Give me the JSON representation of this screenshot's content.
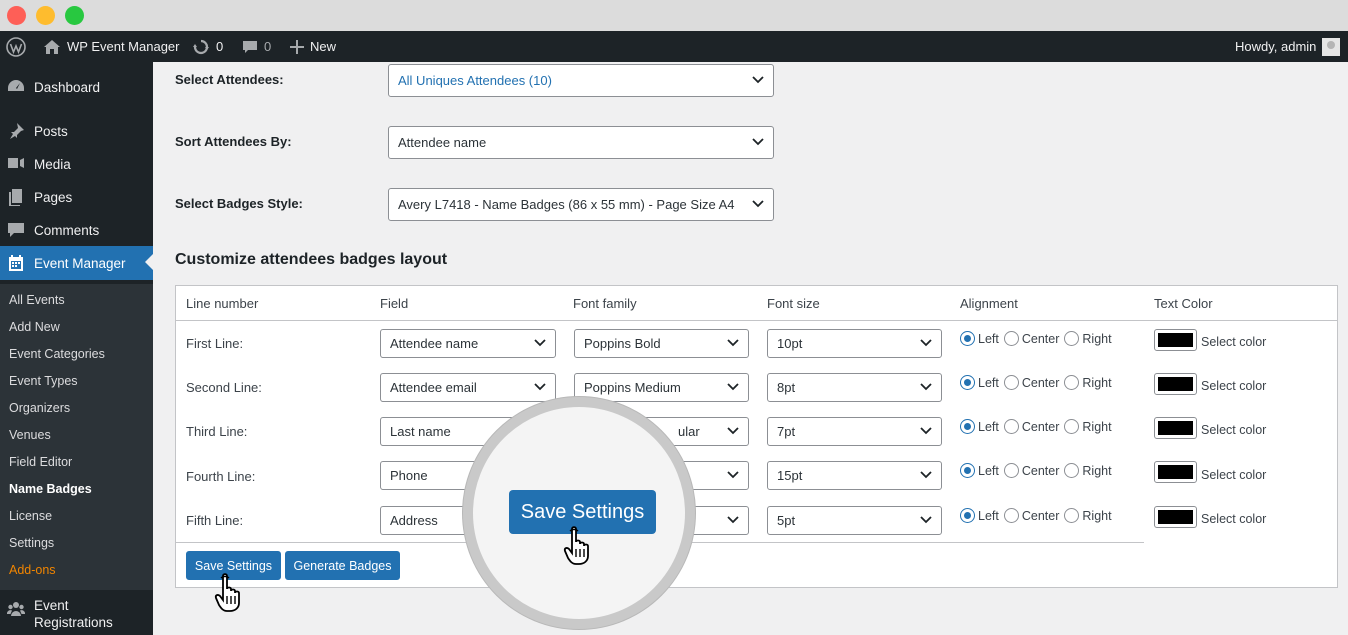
{
  "adminbar": {
    "site_name": "WP Event Manager",
    "updates_count": "0",
    "comments_count": "0",
    "new_label": "New",
    "howdy": "Howdy, admin"
  },
  "sidebar": {
    "menu": [
      {
        "label": "Dashboard",
        "icon": "dashboard-icon"
      },
      {
        "label": "Posts",
        "icon": "pin-icon"
      },
      {
        "label": "Media",
        "icon": "media-icon"
      },
      {
        "label": "Pages",
        "icon": "pages-icon"
      },
      {
        "label": "Comments",
        "icon": "comment-icon"
      },
      {
        "label": "Event Manager",
        "icon": "calendar-icon"
      }
    ],
    "submenu": [
      "All Events",
      "Add New",
      "Event Categories",
      "Event Types",
      "Organizers",
      "Venues",
      "Field Editor",
      "Name Badges",
      "License",
      "Settings",
      "Add-ons"
    ],
    "bottom_item": {
      "line1": "Event",
      "line2": "Registrations"
    }
  },
  "form": {
    "select_attendees": {
      "label": "Select Attendees:",
      "value": "All Uniques Attendees (10)"
    },
    "sort_attendees": {
      "label": "Sort Attendees By:",
      "value": "Attendee name"
    },
    "badges_style": {
      "label": "Select Badges Style:",
      "value": "Avery L7418 - Name Badges (86 x 55 mm) - Page Size A4"
    }
  },
  "layout_section": {
    "title": "Customize attendees badges layout",
    "headers": [
      "Line number",
      "Field",
      "Font family",
      "Font size",
      "Alignment",
      "Text Color"
    ],
    "rows": [
      {
        "line": "First Line:",
        "field": "Attendee name",
        "font": "Poppins Bold",
        "size": "10pt"
      },
      {
        "line": "Second Line:",
        "field": "Attendee email",
        "font": "Poppins Medium",
        "size": "8pt"
      },
      {
        "line": "Third Line:",
        "field": "Last name",
        "font": "ular",
        "size": "7pt"
      },
      {
        "line": "Fourth Line:",
        "field": "Phone",
        "font": "",
        "size": "15pt"
      },
      {
        "line": "Fifth Line:",
        "field": "Address",
        "font": "",
        "size": "5pt"
      }
    ],
    "alignment_options": [
      "Left",
      "Center",
      "Right"
    ],
    "select_color_label": "Select color",
    "text_color": "#000000"
  },
  "buttons": {
    "save": "Save Settings",
    "generate": "Generate Badges"
  },
  "zoom": {
    "button_label": "Save Settings"
  },
  "colors": {
    "accent": "#2271b1",
    "addons": "#f18500",
    "admin_bg": "#1d2327"
  }
}
